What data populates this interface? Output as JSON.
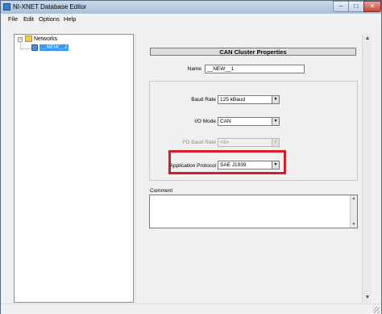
{
  "window": {
    "title": "NI-XNET Database Editor",
    "min_glyph": "‒",
    "max_glyph": "□",
    "close_glyph": "✕"
  },
  "menu": [
    "File",
    "Edit",
    "Options",
    "Help"
  ],
  "tree": {
    "toggle_glyph": "−",
    "root_label": "Networks",
    "child_label": "__NEW__1"
  },
  "panel": {
    "title": "CAN Cluster Properties",
    "name_label": "Name",
    "name_value": "__NEW__1",
    "baud_rate_label": "Baud Rate",
    "baud_rate_value": "125 kBaud",
    "io_mode_label": "I/O Mode",
    "io_mode_value": "CAN",
    "fd_baud_rate_label": "FD Baud Rate",
    "fd_baud_rate_value": "<0>",
    "app_protocol_label": "Application Protocol",
    "app_protocol_value": "SAE J1939",
    "comment_label": "Comment",
    "comment_value": "",
    "dropdown_glyph": "▼"
  },
  "scroll": {
    "up_glyph": "▲",
    "down_glyph": "▼"
  },
  "colors": {
    "highlight": "#d41f2b",
    "selection": "#3399ff"
  }
}
